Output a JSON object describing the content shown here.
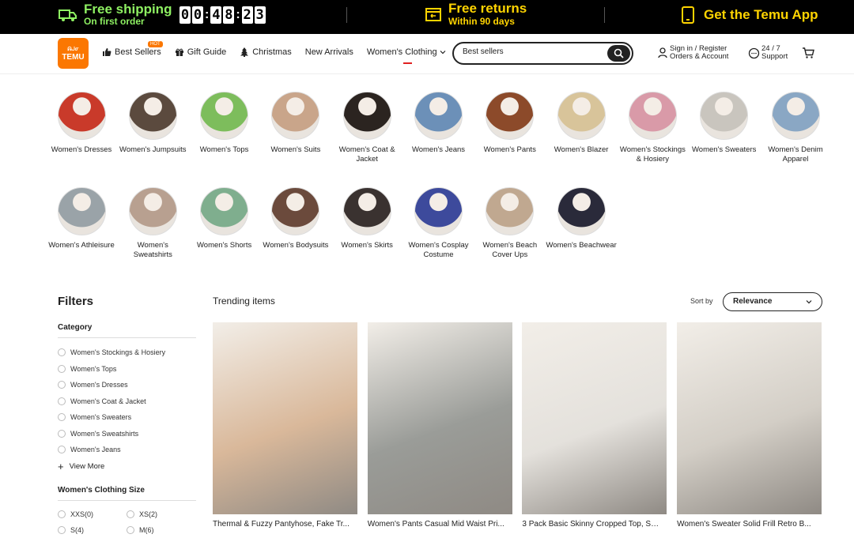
{
  "promo": {
    "shipping_title": "Free shipping",
    "shipping_sub": "On first order",
    "timer": [
      "0",
      "0",
      "4",
      "8",
      "2",
      "3"
    ],
    "returns_title": "Free returns",
    "returns_sub": "Within 90 days",
    "app_label": "Get the Temu App"
  },
  "header": {
    "logo_line1": "ᕱᒍᓂ",
    "logo_line2": "TEMU",
    "nav": [
      {
        "label": "Best Sellers",
        "badge": "HOT"
      },
      {
        "label": "Gift Guide"
      },
      {
        "label": "Christmas"
      },
      {
        "label": "New Arrivals"
      },
      {
        "label": "Women's Clothing"
      }
    ],
    "search_value": "Best sellers",
    "account_line1": "Sign in / Register",
    "account_line2": "Orders & Account",
    "support_line1": "24 / 7",
    "support_line2": "Support"
  },
  "categories": [
    {
      "label": "Women's Dresses",
      "color": "#c93a2a"
    },
    {
      "label": "Women's Jumpsuits",
      "color": "#5b4a3e"
    },
    {
      "label": "Women's Tops",
      "color": "#7dbd5c"
    },
    {
      "label": "Women's Suits",
      "color": "#c9a58a"
    },
    {
      "label": "Women's Coat & Jacket",
      "color": "#2b2420"
    },
    {
      "label": "Women's Jeans",
      "color": "#6c90b8"
    },
    {
      "label": "Women's Pants",
      "color": "#8c4a2a"
    },
    {
      "label": "Women's Blazer",
      "color": "#d8c49a"
    },
    {
      "label": "Women's Stockings & Hosiery",
      "color": "#d99aa8"
    },
    {
      "label": "Women's Sweaters",
      "color": "#c9c5be"
    },
    {
      "label": "Women's Denim Apparel",
      "color": "#8aa7c4"
    },
    {
      "label": "Women's Athleisure",
      "color": "#9aa3a8"
    },
    {
      "label": "Women's Sweatshirts",
      "color": "#b8a090"
    },
    {
      "label": "Women's Shorts",
      "color": "#7fae8e"
    },
    {
      "label": "Women's Bodysuits",
      "color": "#6b4a3c"
    },
    {
      "label": "Women's Skirts",
      "color": "#3a3230"
    },
    {
      "label": "Women's Cosplay Costume",
      "color": "#3d4a9c"
    },
    {
      "label": "Women's Beach Cover Ups",
      "color": "#c0a890"
    },
    {
      "label": "Women's Beachwear",
      "color": "#2a2a3a"
    }
  ],
  "filters": {
    "title": "Filters",
    "category_title": "Category",
    "category_options": [
      "Women's Stockings & Hosiery",
      "Women's Tops",
      "Women's Dresses",
      "Women's Coat & Jacket",
      "Women's Sweaters",
      "Women's Sweatshirts",
      "Women's Jeans"
    ],
    "view_more": "View More",
    "size_title": "Women's Clothing Size",
    "sizes": [
      "XXS(0)",
      "XS(2)",
      "S(4)",
      "M(6)"
    ]
  },
  "trending": {
    "title": "Trending items",
    "sort_label": "Sort by",
    "sort_value": "Relevance",
    "products": [
      {
        "title": "Thermal & Fuzzy Pantyhose, Fake Tr...",
        "bg": "#d9b89a"
      },
      {
        "title": "Women's Pants Casual Mid Waist Pri...",
        "bg": "#9a9c98"
      },
      {
        "title": "3 Pack Basic Skinny Cropped Top, Sh...",
        "bg": "#e4e1dc"
      },
      {
        "title": "Women's Sweater Solid Frill Retro B...",
        "bg": "#d3cec6"
      }
    ]
  }
}
